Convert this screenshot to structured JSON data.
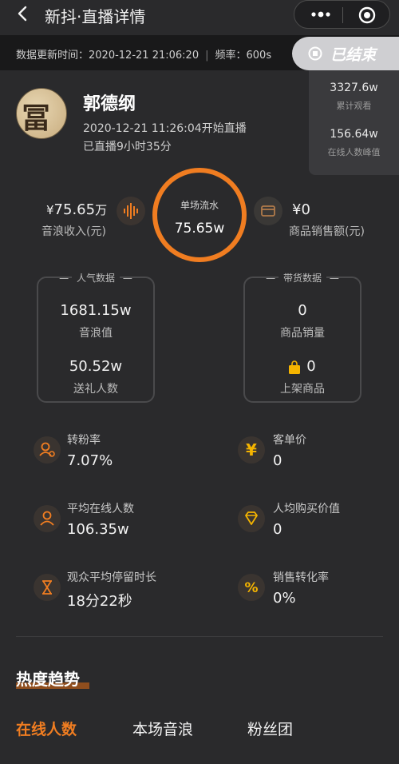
{
  "nav": {
    "title": "新抖·直播详情"
  },
  "info": {
    "update_label": "数据更新时间：",
    "update_time": "2020-12-21 21:06:20",
    "freq_label": "频率：",
    "freq_value": "600s",
    "status": "已结束"
  },
  "side": {
    "total_views": "3327.6w",
    "total_views_label": "累计观看",
    "peak_online": "156.64w",
    "peak_online_label": "在线人数峰值"
  },
  "anchor": {
    "name": "郭德纲",
    "avatar_text": "冨",
    "start": "2020-12-21 11:26:04开始直播",
    "duration": "已直播9小时35分"
  },
  "summary": {
    "sound_income_prefix": "¥",
    "sound_income_value": "75.65",
    "sound_income_unit": "万",
    "sound_income_label": "音浪收入(元)",
    "flow_label": "单场流水",
    "flow_value": "75.65w",
    "sales_value": "¥0",
    "sales_label": "商品销售额(元)"
  },
  "popularity": {
    "header": "人气数据",
    "sound_value": "1681.15w",
    "sound_label": "音浪值",
    "gifters_value": "50.52w",
    "gifters_label": "送礼人数"
  },
  "goods": {
    "header": "带货数据",
    "sales_count": "0",
    "sales_count_label": "商品销量",
    "listed": "0",
    "listed_label": "上架商品"
  },
  "metrics": {
    "fan_rate_label": "转粉率",
    "fan_rate": "7.07%",
    "avg_order_label": "客单价",
    "avg_order": "0",
    "avg_online_label": "平均在线人数",
    "avg_online": "106.35w",
    "per_capita_label": "人均购买价值",
    "per_capita": "0",
    "stay_label": "观众平均停留时长",
    "stay": "18分22秒",
    "conversion_label": "销售转化率",
    "conversion": "0%"
  },
  "trend": {
    "title": "热度趋势",
    "tabs": [
      "在线人数",
      "本场音浪",
      "粉丝团"
    ]
  },
  "colors": {
    "accent": "#f07d21",
    "background": "#2a2a2c"
  }
}
